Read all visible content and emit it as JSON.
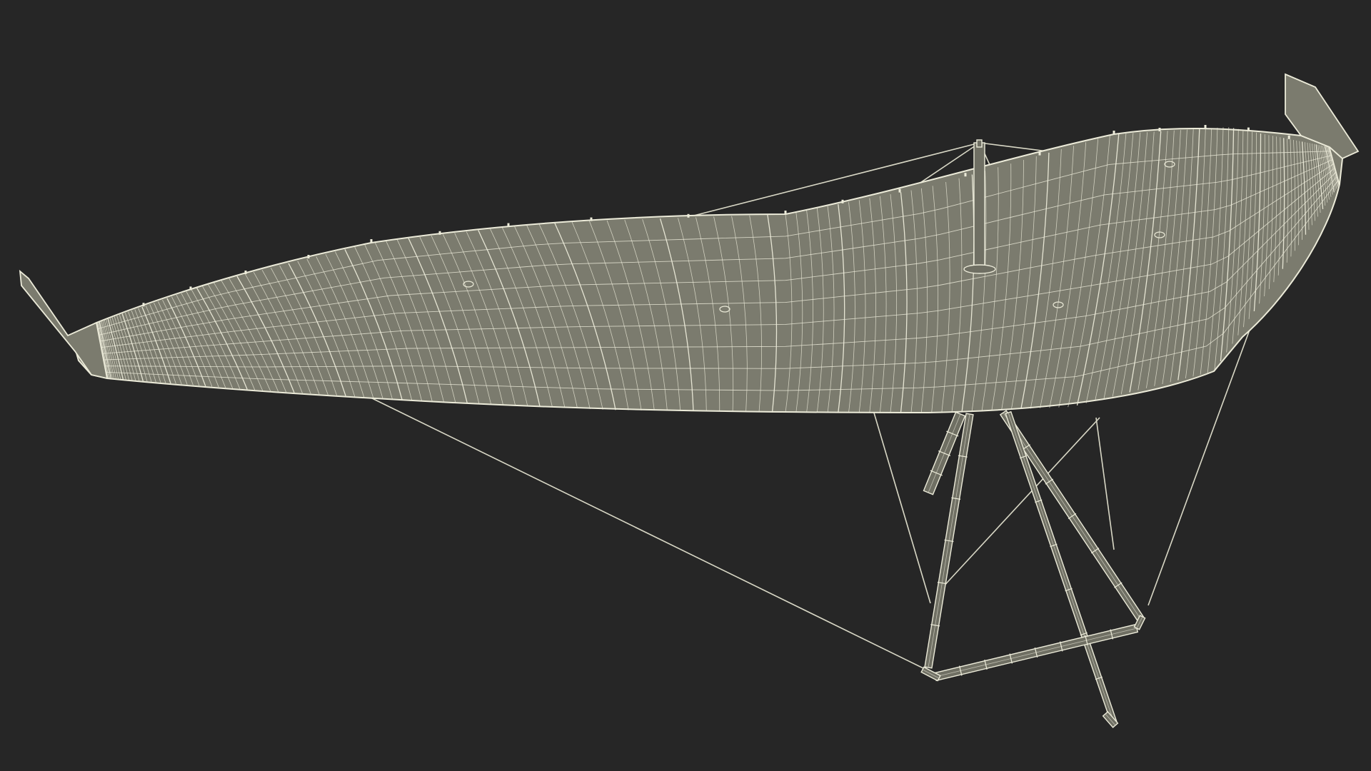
{
  "scene": {
    "subject": "hang-glider-wireframe",
    "colors": {
      "background": "#262626",
      "sail_fill": "#7b7b6e",
      "wire": "#ecebd9",
      "wire_faint": "#bdbcae",
      "cable": "#d9d8c6"
    }
  }
}
